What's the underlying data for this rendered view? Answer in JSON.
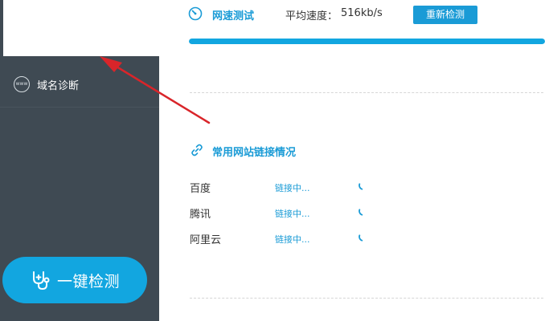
{
  "sidebar": {
    "items": [
      {
        "icon": "www-globe-icon",
        "icon_text": "www",
        "label": "域名诊断"
      }
    ],
    "one_key_button": {
      "icon": "stethoscope-icon",
      "label": "一键检测"
    }
  },
  "speed_test": {
    "title": "网速测试",
    "avg_label": "平均速度：",
    "avg_value": "516kb/s",
    "retest_label": "重新检测",
    "progress": 1.0
  },
  "common_sites": {
    "title": "常用网站链接情况",
    "rows": [
      {
        "name": "百度",
        "status": "链接中..."
      },
      {
        "name": "腾讯",
        "status": "链接中..."
      },
      {
        "name": "阿里云",
        "status": "链接中..."
      }
    ]
  },
  "colors": {
    "sidebar_bg": "#3f4a53",
    "accent": "#1a9bd6",
    "button_bg": "#12a6e0",
    "annotation_arrow": "#d9252a"
  }
}
